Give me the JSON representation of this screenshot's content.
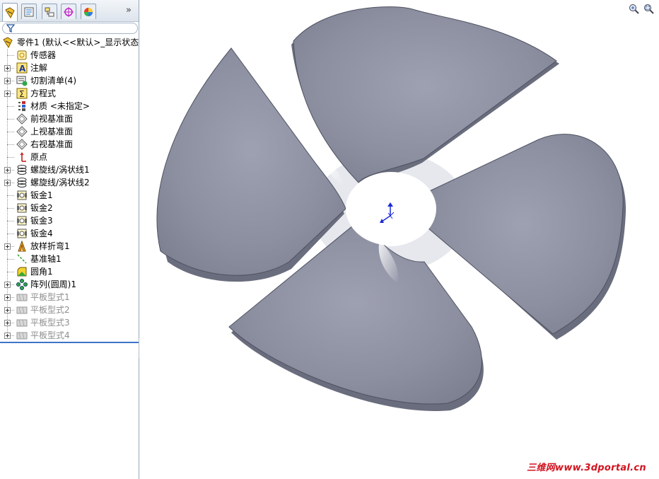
{
  "tabs": [
    {
      "id": "feature-manager",
      "icon": "feature-manager-icon"
    },
    {
      "id": "property-manager",
      "icon": "property-manager-icon"
    },
    {
      "id": "configuration-manager",
      "icon": "configuration-manager-icon"
    },
    {
      "id": "dimxpert-manager",
      "icon": "dimxpert-icon"
    },
    {
      "id": "display-manager",
      "icon": "display-manager-icon"
    }
  ],
  "expand_glyph": "»",
  "tree": {
    "root": "零件1 (默认<<默认>_显示状态",
    "items": [
      {
        "label": "传感器",
        "icon": "sensor-icon",
        "expandable": false,
        "suppressed": false
      },
      {
        "label": "注解",
        "icon": "annotation-icon",
        "expandable": true,
        "suppressed": false
      },
      {
        "label": "切割清单(4)",
        "icon": "cut-list-icon",
        "expandable": true,
        "suppressed": false
      },
      {
        "label": "方程式",
        "icon": "equation-icon",
        "expandable": true,
        "suppressed": false
      },
      {
        "label": "材质 <未指定>",
        "icon": "material-icon",
        "expandable": false,
        "suppressed": false
      },
      {
        "label": "前视基准面",
        "icon": "plane-icon",
        "expandable": false,
        "suppressed": false
      },
      {
        "label": "上视基准面",
        "icon": "plane-icon",
        "expandable": false,
        "suppressed": false
      },
      {
        "label": "右视基准面",
        "icon": "plane-icon",
        "expandable": false,
        "suppressed": false
      },
      {
        "label": "原点",
        "icon": "origin-icon",
        "expandable": false,
        "suppressed": false
      },
      {
        "label": "螺旋线/涡状线1",
        "icon": "helix-icon",
        "expandable": true,
        "suppressed": false
      },
      {
        "label": "螺旋线/涡状线2",
        "icon": "helix-icon",
        "expandable": true,
        "suppressed": false
      },
      {
        "label": "钣金1",
        "icon": "sheet-metal-icon",
        "expandable": false,
        "suppressed": false
      },
      {
        "label": "钣金2",
        "icon": "sheet-metal-icon",
        "expandable": false,
        "suppressed": false
      },
      {
        "label": "钣金3",
        "icon": "sheet-metal-icon",
        "expandable": false,
        "suppressed": false
      },
      {
        "label": "钣金4",
        "icon": "sheet-metal-icon",
        "expandable": false,
        "suppressed": false
      },
      {
        "label": "放样折弯1",
        "icon": "lofted-bend-icon",
        "expandable": true,
        "suppressed": false
      },
      {
        "label": "基准轴1",
        "icon": "axis-icon",
        "expandable": false,
        "suppressed": false
      },
      {
        "label": "圆角1",
        "icon": "fillet-icon",
        "expandable": false,
        "suppressed": false
      },
      {
        "label": "阵列(圆周)1",
        "icon": "circular-pattern-icon",
        "expandable": true,
        "suppressed": false
      },
      {
        "label": "平板型式1",
        "icon": "flat-pattern-icon",
        "expandable": true,
        "suppressed": true
      },
      {
        "label": "平板型式2",
        "icon": "flat-pattern-icon",
        "expandable": true,
        "suppressed": true
      },
      {
        "label": "平板型式3",
        "icon": "flat-pattern-icon",
        "expandable": true,
        "suppressed": true
      },
      {
        "label": "平板型式4",
        "icon": "flat-pattern-icon",
        "expandable": true,
        "suppressed": true
      }
    ]
  },
  "viewport": {
    "hud_icons": [
      "zoom-to-fit-icon",
      "zoom-to-area-icon"
    ],
    "model_color": "#8a8d9c"
  },
  "watermark": "三维网www.3dportal.cn"
}
